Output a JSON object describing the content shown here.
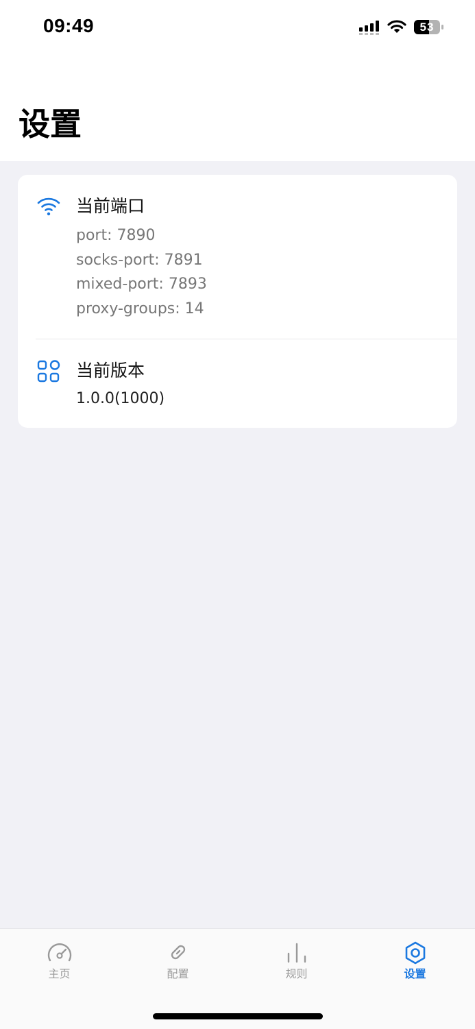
{
  "status_bar": {
    "time": "09:49",
    "battery": "53"
  },
  "header": {
    "title": "设置"
  },
  "card": {
    "ports": {
      "title": "当前端口",
      "icon": "wifi-icon",
      "lines": [
        "port: 7890",
        "socks-port: 7891",
        "mixed-port: 7893",
        "proxy-groups: 14"
      ]
    },
    "version": {
      "title": "当前版本",
      "icon": "grid-icon",
      "value": "1.0.0(1000)"
    }
  },
  "tabs": [
    {
      "label": "主页",
      "icon": "speedometer-icon",
      "active": false
    },
    {
      "label": "配置",
      "icon": "link-icon",
      "active": false
    },
    {
      "label": "规则",
      "icon": "chart-bars-icon",
      "active": false
    },
    {
      "label": "设置",
      "icon": "settings-hexagon-icon",
      "active": true
    }
  ],
  "colors": {
    "accent": "#1a78e0",
    "background": "#f1f1f6",
    "inactive": "#999999"
  }
}
